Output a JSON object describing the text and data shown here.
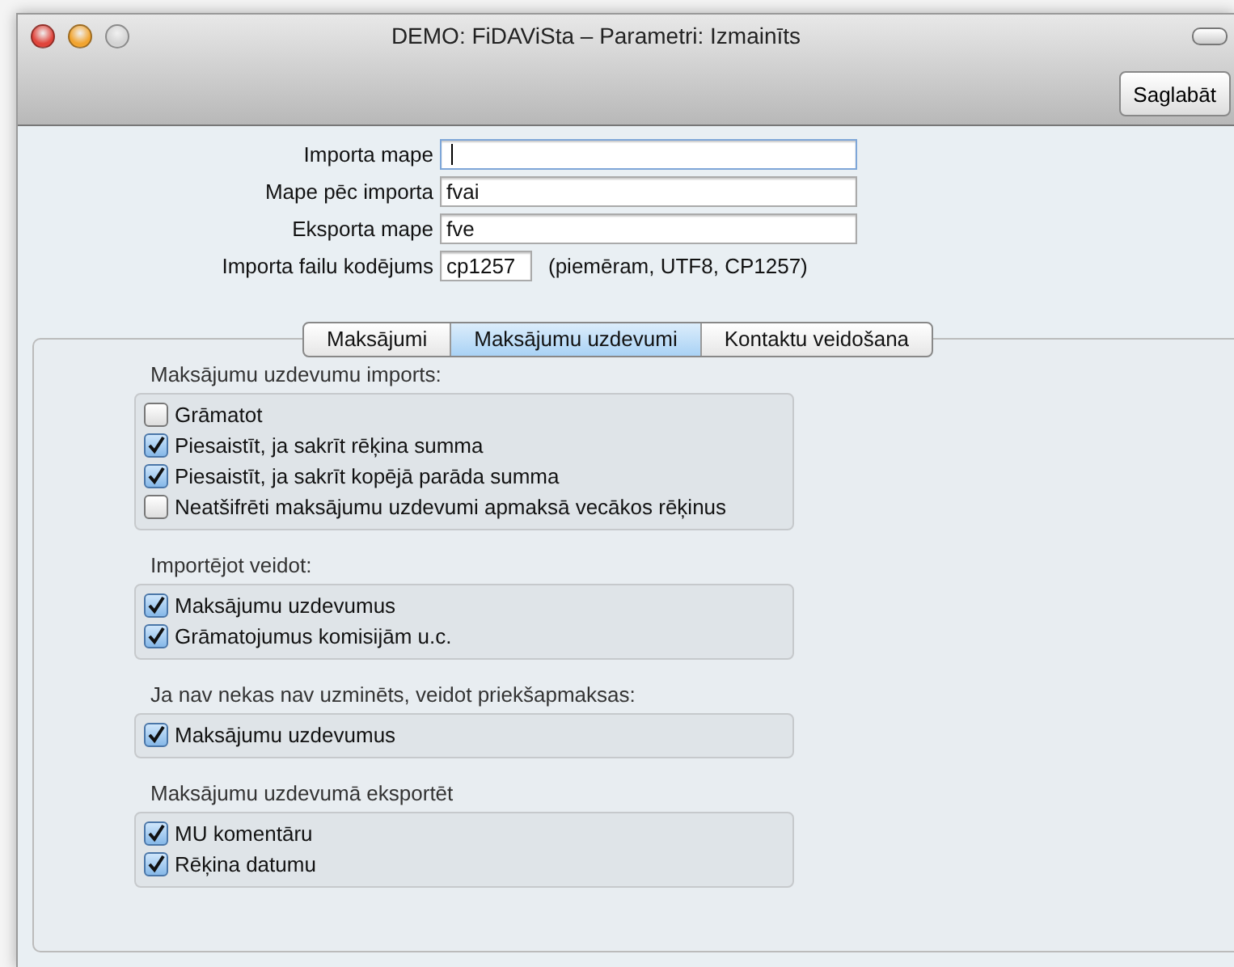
{
  "window": {
    "title": "DEMO: FiDAViSta – Parametri: Izmainīts"
  },
  "toolbar": {
    "buttons": [
      "Saglabāt"
    ]
  },
  "fields": [
    {
      "label": "Importa mape",
      "focused": true,
      "kind": "wide"
    },
    {
      "label": "Mape pēc importa",
      "value": "fvai",
      "focused": false,
      "kind": "wide"
    },
    {
      "label": "Eksporta mape",
      "value": "fve",
      "focused": false,
      "kind": "wide"
    },
    {
      "label": "Importa failu kodējums",
      "value": "cp1257",
      "focused": false,
      "kind": "short",
      "hint": "(piemēram, UTF8, CP1257)"
    }
  ],
  "tabs": [
    {
      "label": "Maksājumi",
      "selected": false
    },
    {
      "label": "Maksājumu uzdevumi",
      "selected": true
    },
    {
      "label": "Kontaktu veidošana",
      "selected": false
    }
  ],
  "groups": [
    {
      "title": "Maksājumu uzdevumu imports:",
      "items": [
        {
          "label": "Grāmatot",
          "checked": false
        },
        {
          "label": "Piesaistīt, ja sakrīt rēķina summa",
          "checked": true
        },
        {
          "label": "Piesaistīt, ja sakrīt kopējā parāda summa",
          "checked": true
        },
        {
          "label": "Neatšifrēti maksājumu uzdevumi apmaksā vecākos rēķinus",
          "checked": false
        }
      ]
    },
    {
      "title": "Importējot veidot:",
      "items": [
        {
          "label": "Maksājumu uzdevumus",
          "checked": true
        },
        {
          "label": "Grāmatojumus komisijām u.c.",
          "checked": true
        }
      ]
    },
    {
      "title": "Ja nav nekas nav uzminēts, veidot priekšapmaksas:",
      "items": [
        {
          "label": "Maksājumu uzdevumus",
          "checked": true
        }
      ]
    },
    {
      "title": "Maksājumu uzdevumā eksportēt",
      "items": [
        {
          "label": "MU komentāru",
          "checked": true
        },
        {
          "label": "Rēķina datumu",
          "checked": true
        }
      ]
    }
  ]
}
